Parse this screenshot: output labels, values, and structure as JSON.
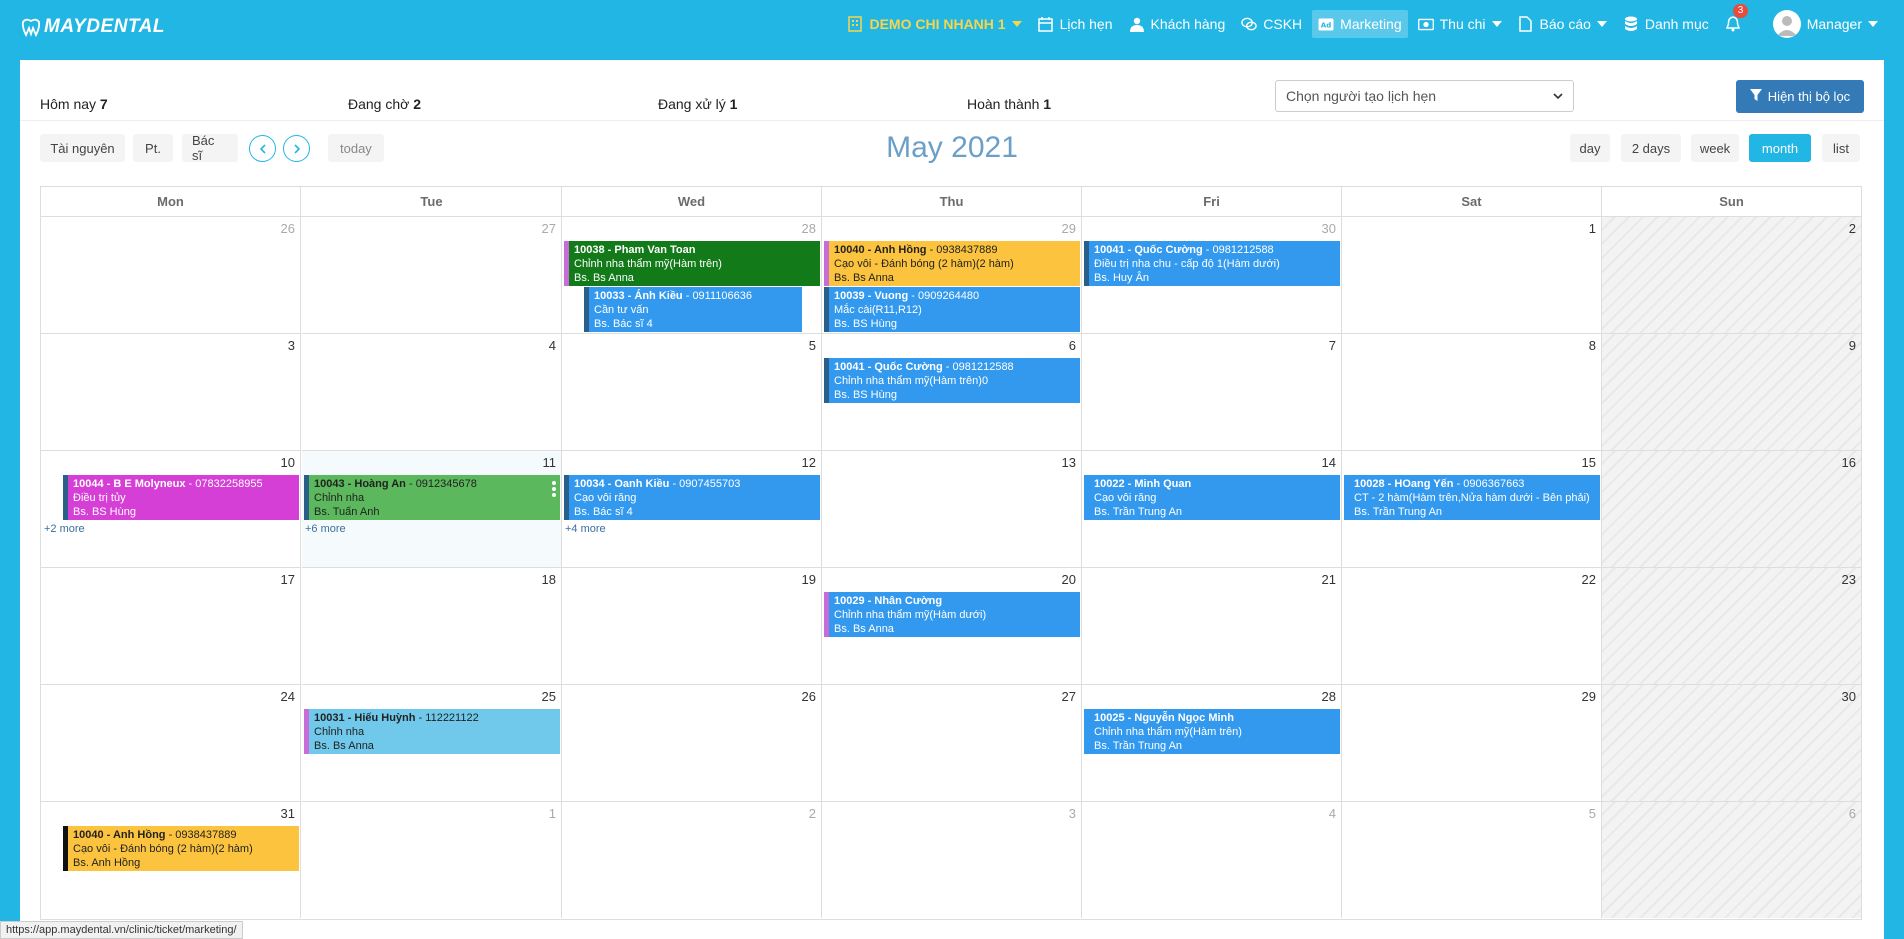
{
  "brand": {
    "logo_text": "MAYDENTAL"
  },
  "nav": {
    "branch": "DEMO CHI NHANH 1",
    "appointments": "Lịch hẹn",
    "customers": "Khách hàng",
    "cskh": "CSKH",
    "marketing": "Marketing",
    "finance": "Thu chi",
    "reports": "Báo cáo",
    "catalog": "Danh mục",
    "notifications_count": "3",
    "user": "Manager"
  },
  "stats": {
    "today_label": "Hôm nay",
    "today_value": "7",
    "waiting_label": "Đang chờ",
    "waiting_value": "2",
    "processing_label": "Đang xử lý",
    "processing_value": "1",
    "done_label": "Hoàn thành",
    "done_value": "1"
  },
  "filters": {
    "creator_placeholder": "Chọn người tạo lịch hẹn",
    "show_filter": "Hiện thị bộ lọc"
  },
  "toolbar": {
    "resources": "Tài nguyên",
    "pt": "Pt.",
    "doctor": "Bác sĩ",
    "today": "today",
    "title": "May 2021",
    "views": [
      "day",
      "2 days",
      "week",
      "month",
      "list"
    ],
    "active_view": "month"
  },
  "calendar": {
    "weekdays": [
      "Mon",
      "Tue",
      "Wed",
      "Thu",
      "Fri",
      "Sat",
      "Sun"
    ],
    "weeks": [
      [
        {
          "d": "26",
          "o": true
        },
        {
          "d": "27",
          "o": true
        },
        {
          "d": "28",
          "o": true
        },
        {
          "d": "29",
          "o": true
        },
        {
          "d": "30",
          "o": true
        },
        {
          "d": "1"
        },
        {
          "d": "2"
        }
      ],
      [
        {
          "d": "3"
        },
        {
          "d": "4"
        },
        {
          "d": "5"
        },
        {
          "d": "6"
        },
        {
          "d": "7"
        },
        {
          "d": "8"
        },
        {
          "d": "9"
        }
      ],
      [
        {
          "d": "10"
        },
        {
          "d": "11"
        },
        {
          "d": "12"
        },
        {
          "d": "13"
        },
        {
          "d": "14"
        },
        {
          "d": "15"
        },
        {
          "d": "16"
        }
      ],
      [
        {
          "d": "17"
        },
        {
          "d": "18"
        },
        {
          "d": "19"
        },
        {
          "d": "20"
        },
        {
          "d": "21"
        },
        {
          "d": "22"
        },
        {
          "d": "23"
        }
      ],
      [
        {
          "d": "24"
        },
        {
          "d": "25"
        },
        {
          "d": "26"
        },
        {
          "d": "27"
        },
        {
          "d": "28"
        },
        {
          "d": "29"
        },
        {
          "d": "30"
        }
      ],
      [
        {
          "d": "31"
        },
        {
          "d": "1",
          "o": true
        },
        {
          "d": "2",
          "o": true
        },
        {
          "d": "3",
          "o": true
        },
        {
          "d": "4",
          "o": true
        },
        {
          "d": "5",
          "o": true
        },
        {
          "d": "6",
          "o": true
        }
      ]
    ],
    "events": [
      {
        "week": 0,
        "day": 2,
        "slot": 0,
        "id": "10038",
        "name": "Pham Van Toan",
        "phone": "",
        "service": "Chỉnh nha thẩm mỹ(Hàm trên)",
        "doctor": "Bs. Bs Anna",
        "bg": "#137a1a",
        "border": "#c86dd7",
        "text": "light"
      },
      {
        "week": 0,
        "day": 2,
        "slot": 1,
        "id": "10033",
        "name": "Ánh Kiều",
        "phone": "0911106636",
        "service": "Cần tư vấn",
        "doctor": "Bs. Bác sĩ 4",
        "bg": "#3399ee",
        "border": "#2a5f8a",
        "text": "light",
        "indent": true
      },
      {
        "week": 0,
        "day": 3,
        "slot": 0,
        "id": "10040",
        "name": "Anh Hồng",
        "phone": "0938437889",
        "service": "Cạo vôi - Đánh bóng (2 hàm)(2 hàm)",
        "doctor": "Bs. Bs Anna",
        "bg": "#fcc43e",
        "border": "#c86dd7",
        "text": "dark"
      },
      {
        "week": 0,
        "day": 3,
        "slot": 1,
        "id": "10039",
        "name": "Vuong",
        "phone": "0909264480",
        "service": "Mắc cài(R11,R12)",
        "doctor": "Bs. BS Hùng",
        "bg": "#3399ee",
        "border": "#2a5f8a",
        "text": "light"
      },
      {
        "week": 0,
        "day": 4,
        "slot": 0,
        "id": "10041",
        "name": "Quốc Cường",
        "phone": "0981212588",
        "service": "Điều trị nha chu - cấp độ 1(Hàm dưới)",
        "doctor": "Bs. Huy Ân",
        "bg": "#3399ee",
        "border": "#2a5f8a",
        "text": "light"
      },
      {
        "week": 1,
        "day": 3,
        "slot": 0,
        "id": "10041",
        "name": "Quốc Cường",
        "phone": "0981212588",
        "service": "Chỉnh nha thẩm mỹ(Hàm trên)0",
        "doctor": "Bs. BS Hùng",
        "bg": "#3399ee",
        "border": "#2a5f8a",
        "text": "light"
      },
      {
        "week": 2,
        "day": 0,
        "slot": 0,
        "id": "10044",
        "name": "B E Molyneux",
        "phone": "07832258955",
        "service": "Điều trị tủy",
        "doctor": "Bs. BS Hùng",
        "bg": "#d63fd6",
        "border": "#2a5f8a",
        "text": "light"
      },
      {
        "week": 2,
        "day": 1,
        "slot": 0,
        "id": "10043",
        "name": "Hoàng An",
        "phone": "0912345678",
        "service": "Chỉnh nha",
        "doctor": "Bs. Tuấn Anh",
        "bg": "#5cb85c",
        "border": "#2a5f8a",
        "text": "dark",
        "kebab": true
      },
      {
        "week": 2,
        "day": 2,
        "slot": 0,
        "id": "10034",
        "name": "Oanh Kiều",
        "phone": "0907455703",
        "service": "Cạo vôi răng",
        "doctor": "Bs. Bác sĩ 4",
        "bg": "#3399ee",
        "border": "#2a5f8a",
        "text": "light"
      },
      {
        "week": 2,
        "day": 4,
        "slot": 0,
        "id": "10022",
        "name": "Minh Quan",
        "phone": "",
        "service": "Cạo vôi răng",
        "doctor": "Bs. Trần Trung An",
        "bg": "#3399ee",
        "border": "#3399ee",
        "text": "light"
      },
      {
        "week": 2,
        "day": 5,
        "slot": 0,
        "id": "10028",
        "name": "HOang Yến",
        "phone": "0906367663",
        "service": "CT - 2 hàm(Hàm trên,Nửa hàm dưới - Bên phải)",
        "doctor": "Bs. Trần Trung An",
        "bg": "#3399ee",
        "border": "#3399ee",
        "text": "light"
      },
      {
        "week": 3,
        "day": 3,
        "slot": 0,
        "id": "10029",
        "name": "Nhân Cường",
        "phone": "",
        "service": "Chỉnh nha thẩm mỹ(Hàm dưới)",
        "doctor": "Bs. Bs Anna",
        "bg": "#3399ee",
        "border": "#c86dd7",
        "text": "light"
      },
      {
        "week": 4,
        "day": 1,
        "slot": 0,
        "id": "10031",
        "name": "Hiếu Huỳnh",
        "phone": "112221122",
        "service": "Chỉnh nha",
        "doctor": "Bs. Bs Anna",
        "bg": "#70c8ea",
        "border": "#c86dd7",
        "text": "dark"
      },
      {
        "week": 4,
        "day": 4,
        "slot": 0,
        "id": "10025",
        "name": "Nguyễn Ngọc Minh",
        "phone": "",
        "service": "Chỉnh nha thẩm mỹ(Hàm trên)",
        "doctor": "Bs. Trần Trung An",
        "bg": "#3399ee",
        "border": "#3399ee",
        "text": "light"
      },
      {
        "week": 5,
        "day": 0,
        "slot": 0,
        "id": "10040",
        "name": "Anh Hồng",
        "phone": "0938437889",
        "service": "Cạo vôi - Đánh bóng (2 hàm)(2 hàm)",
        "doctor": "Bs. Anh Hồng",
        "bg": "#fcc43e",
        "border": "#111111",
        "text": "dark"
      }
    ],
    "more_links": [
      {
        "week": 2,
        "day": 0,
        "label": "+2 more"
      },
      {
        "week": 2,
        "day": 1,
        "label": "+6 more"
      },
      {
        "week": 2,
        "day": 2,
        "label": "+4 more"
      }
    ]
  },
  "status_url": "https://app.maydental.vn/clinic/ticket/marketing/"
}
